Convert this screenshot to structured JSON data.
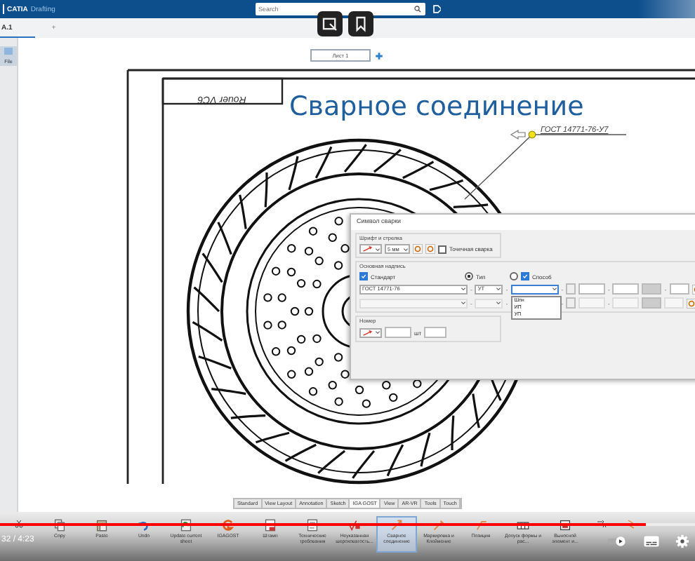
{
  "app": {
    "brand": "CATIA",
    "module": "Drafting"
  },
  "search": {
    "placeholder": "Search"
  },
  "document_tabs": [
    {
      "label": "A.1",
      "selected": true
    }
  ],
  "new_tab": "+",
  "left_panel": {
    "button": "File"
  },
  "sheet_tabs": [
    {
      "label": "Лист 1",
      "selected": true
    }
  ],
  "drawing": {
    "title_block": "Rouer VC6",
    "heading": "Сварное соединение",
    "weld_label": "ГОСТ 14771-76-У7"
  },
  "weld_dialog": {
    "title": "Символ сварки",
    "font_group": {
      "title": "Шрифт и стрелка",
      "size": "5 мм",
      "spot_weld": {
        "label": "Точечная сварка",
        "checked": false
      }
    },
    "main_group": {
      "title": "Основная надпись",
      "standard": {
        "label": "Стандарт",
        "checked": true
      },
      "type_radio": {
        "label": "Тип",
        "selected": true
      },
      "other_radio": {
        "selected": false
      },
      "method": {
        "label": "Способ",
        "checked": true
      },
      "standard_value": "ГОСТ 14771-76",
      "type_value": "УТ",
      "method_expanded": true,
      "method_options": [
        "Шпн",
        "ИП",
        "УП"
      ],
      "row1_separators": [
        "-",
        "-",
        "-",
        "-",
        "-"
      ],
      "row2_separators": [
        "-",
        "-",
        "-",
        "-"
      ]
    },
    "number_group": {
      "title": "Номер",
      "unit": "шт"
    }
  },
  "workbench_tabs": [
    {
      "label": "Standard",
      "selected": false
    },
    {
      "label": "View Layout",
      "selected": false
    },
    {
      "label": "Annotation",
      "selected": false
    },
    {
      "label": "Sketch",
      "selected": false
    },
    {
      "label": "IGA GOST",
      "selected": true
    },
    {
      "label": "View",
      "selected": false
    },
    {
      "label": "AR-VR",
      "selected": false
    },
    {
      "label": "Tools",
      "selected": false
    },
    {
      "label": "Touch",
      "selected": false
    }
  ],
  "ribbon": [
    {
      "kind": "cut",
      "selected": false
    },
    {
      "kind": "copy",
      "label": "Copy",
      "selected": false
    },
    {
      "kind": "paste",
      "label": "Paste",
      "selected": false
    },
    {
      "kind": "undo",
      "label": "Undo",
      "selected": false
    },
    {
      "kind": "update",
      "label": "Update current sheet",
      "selected": false
    },
    {
      "kind": "logo",
      "label": "IGAGOST",
      "selected": false
    },
    {
      "kind": "stamp",
      "label": "Штамп",
      "selected": false
    },
    {
      "kind": "doc",
      "label": "Технические требования",
      "selected": false
    },
    {
      "kind": "rough",
      "label": "Неуказанная шероховатость...",
      "selected": false
    },
    {
      "kind": "weld",
      "label": "Сварное соединение",
      "selected": true
    },
    {
      "kind": "mark",
      "label": "Маркировка и Клеймение",
      "selected": false
    },
    {
      "kind": "pos",
      "label": "Позиция",
      "selected": false
    },
    {
      "kind": "tol",
      "label": "Допуск формы и рас...",
      "selected": false
    },
    {
      "kind": "detail",
      "label": "Выносной элемент и...",
      "selected": false
    },
    {
      "kind": "text",
      "selected": false
    },
    {
      "kind": "break",
      "selected": false
    }
  ],
  "player": {
    "time": "32 / 4:23",
    "level": 0.93
  }
}
